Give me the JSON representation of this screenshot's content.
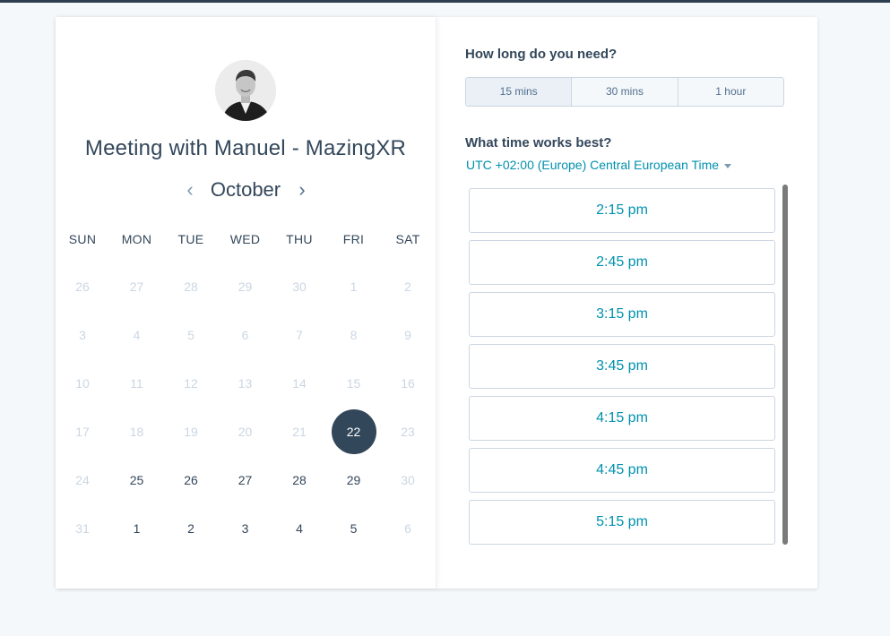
{
  "meeting": {
    "title": "Meeting with Manuel - MazingXR",
    "avatar_icon": "person-photo-icon"
  },
  "calendar": {
    "month": "October",
    "prev_icon": "chevron-left-icon",
    "next_icon": "chevron-right-icon",
    "prev_symbol": "‹",
    "next_symbol": "›",
    "weekdays": [
      "SUN",
      "MON",
      "TUE",
      "WED",
      "THU",
      "FRI",
      "SAT"
    ],
    "weeks": [
      [
        {
          "d": "26",
          "s": "muted"
        },
        {
          "d": "27",
          "s": "muted"
        },
        {
          "d": "28",
          "s": "muted"
        },
        {
          "d": "29",
          "s": "muted"
        },
        {
          "d": "30",
          "s": "muted"
        },
        {
          "d": "1",
          "s": "muted"
        },
        {
          "d": "2",
          "s": "muted"
        }
      ],
      [
        {
          "d": "3",
          "s": "muted"
        },
        {
          "d": "4",
          "s": "muted"
        },
        {
          "d": "5",
          "s": "muted"
        },
        {
          "d": "6",
          "s": "muted"
        },
        {
          "d": "7",
          "s": "muted"
        },
        {
          "d": "8",
          "s": "muted"
        },
        {
          "d": "9",
          "s": "muted"
        }
      ],
      [
        {
          "d": "10",
          "s": "muted"
        },
        {
          "d": "11",
          "s": "muted"
        },
        {
          "d": "12",
          "s": "muted"
        },
        {
          "d": "13",
          "s": "muted"
        },
        {
          "d": "14",
          "s": "muted"
        },
        {
          "d": "15",
          "s": "muted"
        },
        {
          "d": "16",
          "s": "muted"
        }
      ],
      [
        {
          "d": "17",
          "s": "muted"
        },
        {
          "d": "18",
          "s": "muted"
        },
        {
          "d": "19",
          "s": "muted"
        },
        {
          "d": "20",
          "s": "muted"
        },
        {
          "d": "21",
          "s": "muted"
        },
        {
          "d": "22",
          "s": "selected"
        },
        {
          "d": "23",
          "s": "muted"
        }
      ],
      [
        {
          "d": "24",
          "s": "muted"
        },
        {
          "d": "25",
          "s": "active"
        },
        {
          "d": "26",
          "s": "active"
        },
        {
          "d": "27",
          "s": "active"
        },
        {
          "d": "28",
          "s": "active"
        },
        {
          "d": "29",
          "s": "active"
        },
        {
          "d": "30",
          "s": "muted"
        }
      ],
      [
        {
          "d": "31",
          "s": "muted"
        },
        {
          "d": "1",
          "s": "active"
        },
        {
          "d": "2",
          "s": "active"
        },
        {
          "d": "3",
          "s": "active"
        },
        {
          "d": "4",
          "s": "active"
        },
        {
          "d": "5",
          "s": "active"
        },
        {
          "d": "6",
          "s": "muted"
        }
      ]
    ]
  },
  "duration": {
    "label": "How long do you need?",
    "options": [
      "15 mins",
      "30 mins",
      "1 hour"
    ],
    "selected": "15 mins"
  },
  "time": {
    "label": "What time works best?",
    "timezone": "UTC +02:00 (Europe) Central European Time",
    "timezone_icon": "caret-down-icon",
    "slots": [
      "2:15 pm",
      "2:45 pm",
      "3:15 pm",
      "3:45 pm",
      "4:15 pm",
      "4:45 pm",
      "5:15 pm"
    ]
  },
  "colors": {
    "text": "#33475b",
    "accent": "#0091ae",
    "muted": "#cbd6e2",
    "selected_day": "#33475b",
    "background": "#f5f8fa"
  }
}
